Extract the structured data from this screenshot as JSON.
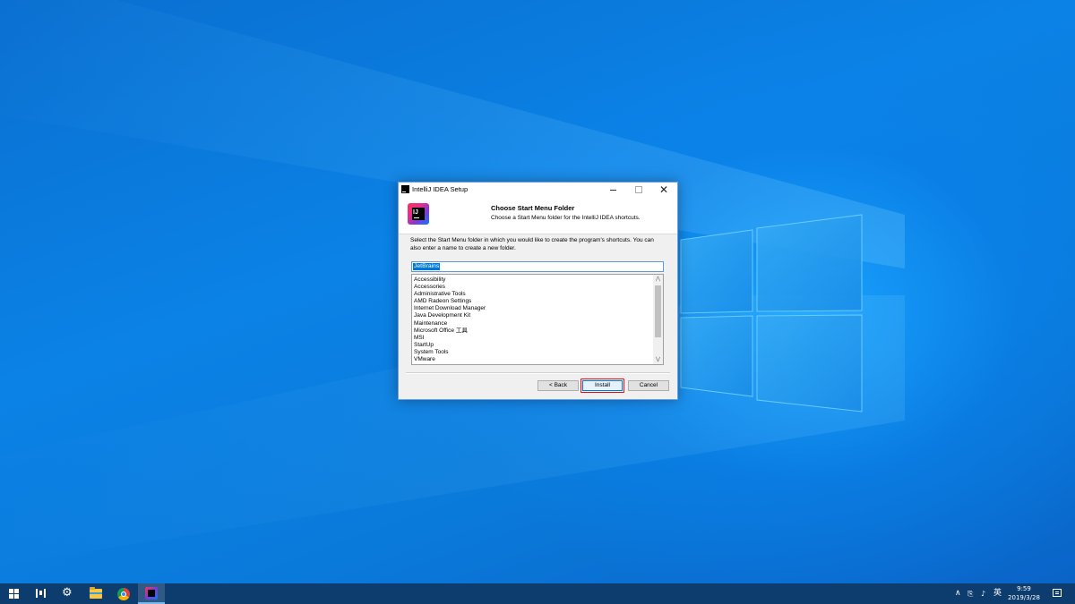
{
  "window": {
    "title": "IntelliJ IDEA Setup",
    "minimize_label": "",
    "maximize_label": "",
    "close_label": "✕"
  },
  "header": {
    "title": "Choose Start Menu Folder",
    "subtitle": "Choose a Start Menu folder for the IntelliJ IDEA shortcuts.",
    "logo_text": "IJ"
  },
  "content": {
    "description": "Select the Start Menu folder in which you would like to create the program's shortcuts. You can also enter a name to create a new folder.",
    "folder_value": "JetBrains",
    "folders": [
      "Accessibility",
      "Accessories",
      "Administrative Tools",
      "AMD Radeon Settings",
      "Internet Download Manager",
      "Java Development Kit",
      "Maintenance",
      "Microsoft Office 工具",
      "MSI",
      "StartUp",
      "System Tools",
      "VMware"
    ]
  },
  "buttons": {
    "back": "< Back",
    "install": "Install",
    "cancel": "Cancel"
  },
  "taskbar": {
    "apps": [
      "start-icon",
      "task-view-icon",
      "settings-icon",
      "file-explorer-icon",
      "chrome-icon",
      "intellij-icon"
    ],
    "active_app": "intellij-icon",
    "tray": {
      "chevron": "∧",
      "network": "⎘",
      "volume": "♪",
      "ime": "英"
    },
    "clock_time": "9:59",
    "clock_date": "2019/3/28"
  },
  "colors": {
    "accent": "#0078d7",
    "highlight_box": "#e01010",
    "taskbar": "#0d3c6e"
  }
}
